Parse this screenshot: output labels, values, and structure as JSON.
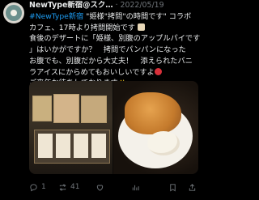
{
  "tweet": {
    "display_name": "NewType新宿@スク…",
    "separator": "·",
    "date": "2022/05/19",
    "lines": [
      {
        "tag": "#NewType新宿",
        "text": " \"姫様\"拷問\"の時間です\" コラボ"
      },
      {
        "text": "カフェ、17時より拷問開始です"
      },
      {
        "text": "食後のデザートに「姫様、別腹のアップルパイです"
      },
      {
        "text": "」はいかがですか？　拷問でパンパンになった"
      },
      {
        "text": "お腹でも、別腹だから大丈夫！　添えられたバニ"
      },
      {
        "text": "ラアイスにからめてもおいしいですよ"
      },
      {
        "text": "ご来年お待ちしております"
      }
    ]
  },
  "actions": {
    "reply_count": "1",
    "retweet_count": "41",
    "like_count": "",
    "views_count": ""
  },
  "icons": {
    "reply": "reply-icon",
    "retweet": "retweet-icon",
    "like": "heart-icon",
    "views": "views-icon",
    "bookmark": "bookmark-icon",
    "share": "share-icon"
  },
  "colors": {
    "background": "#000000",
    "text": "#e7e9ea",
    "muted": "#71767b",
    "link": "#1d9bf0"
  }
}
